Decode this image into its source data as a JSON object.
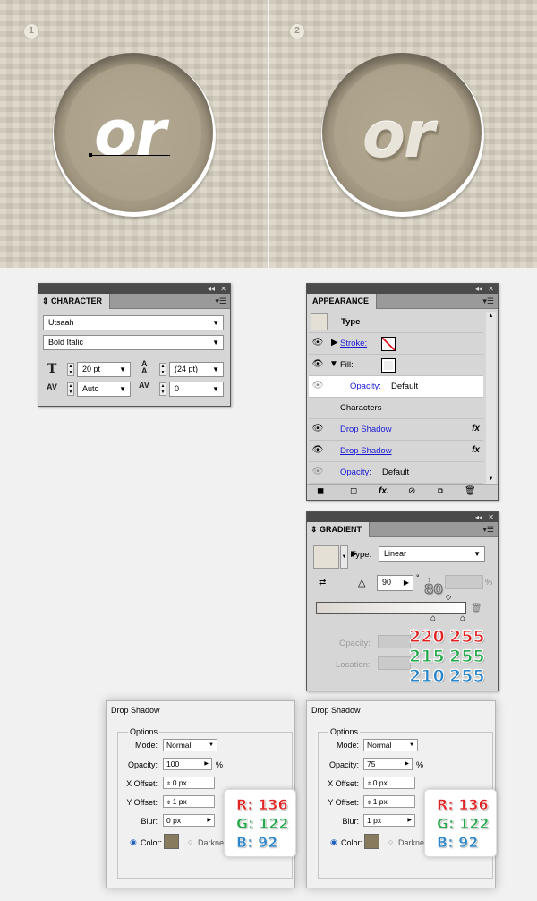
{
  "preview": {
    "steps": [
      "1",
      "2"
    ],
    "word": "or"
  },
  "character": {
    "title": "CHARACTER",
    "font": "Utsaah",
    "style": "Bold Italic",
    "size": "20 pt",
    "leading": "(24 pt)",
    "kerning": "Auto",
    "tracking": "0"
  },
  "appearance": {
    "title": "APPEARANCE",
    "type_label": "Type",
    "stroke_label": "Stroke:",
    "fill_label": "Fill:",
    "fill_opacity_label": "Opacity:",
    "fill_opacity_value": "Default",
    "characters_label": "Characters",
    "drop_shadow_1": "Drop Shadow",
    "drop_shadow_2": "Drop Shadow",
    "opacity_label": "Opacity:",
    "opacity_value": "Default",
    "fx": "fx"
  },
  "gradient": {
    "title": "GRADIENT",
    "type_label": "Type:",
    "type_value": "Linear",
    "angle": "90",
    "location_badge": "80",
    "opacity_label": "Opacity:",
    "location_label": "Location:",
    "percent": "%",
    "degree": "°",
    "stop1": {
      "r": "220",
      "g": "215",
      "b": "210"
    },
    "stop2": {
      "r": "255",
      "g": "255",
      "b": "255"
    },
    "colors": {
      "start": "#dcd7d2",
      "end": "#ffffff"
    }
  },
  "drop_shadow_1": {
    "title": "Drop Shadow",
    "options_label": "Options",
    "mode_label": "Mode:",
    "mode_value": "Normal",
    "opacity_label": "Opacity:",
    "opacity_value": "100",
    "percent": "%",
    "x_label": "X Offset:",
    "x_value": "0 px",
    "y_label": "Y Offset:",
    "y_value": "1 px",
    "blur_label": "Blur:",
    "blur_value": "0 px",
    "color_label": "Color:",
    "darkness_label": "Darknes",
    "swatch": "#887a5c",
    "r": "R: 136",
    "g": "G: 122",
    "b": "B: 92"
  },
  "drop_shadow_2": {
    "title": "Drop Shadow",
    "options_label": "Options",
    "mode_label": "Mode:",
    "mode_value": "Normal",
    "opacity_label": "Opacity:",
    "opacity_value": "75",
    "percent": "%",
    "x_label": "X Offset:",
    "x_value": "0 px",
    "y_label": "Y Offset:",
    "y_value": "1 px",
    "blur_label": "Blur:",
    "blur_value": "1 px",
    "color_label": "Color:",
    "darkness_label": "Darkne",
    "swatch": "#887a5c",
    "r": "R: 136",
    "g": "G: 122",
    "b": "B: 92"
  }
}
